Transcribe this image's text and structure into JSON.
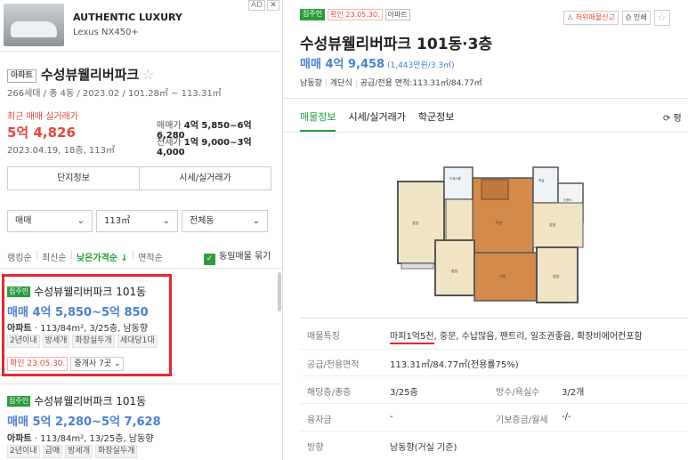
{
  "ad": {
    "title": "AUTHENTIC LUXURY",
    "subtitle": "Lexus NX450+",
    "badge": "AD",
    "close": "✕"
  },
  "complex": {
    "type_badge": "아파트",
    "name": "수성뷰웰리버파크",
    "star": "☆",
    "info": "266세대 / 총 4동 / 2023.02 / 101.28㎡ ~ 113.31㎡",
    "recent_label": "최근 매매 실거래가",
    "recent_price": "5억 4,826",
    "recent_date": "2023.04.19, 18층, 113㎡",
    "sale_label": "매매가",
    "sale_range": "4억 5,850~6억 6,280",
    "jeonse_label": "전세가",
    "jeonse_range": "1억 9,000~3억 4,000"
  },
  "buttons": {
    "complex_info": "단지정보",
    "market_price": "시세/실거래가"
  },
  "filters": {
    "trade": "매매",
    "area": "113㎡",
    "dong": "전체동",
    "chev": "⌄"
  },
  "sort": {
    "ranking": "랭킹순",
    "latest": "최신순",
    "low_price": "낮은가격순 ↓",
    "area": "면적순",
    "sep": "|",
    "group_label": "동일매물 묶기",
    "check": "✓"
  },
  "listings": [
    {
      "badge": "집주인",
      "title": "수성뷰웰리버파크 101동",
      "price": "매매 4억 5,850~5억 850",
      "spec_type": "아파트",
      "spec": " · 113/84m², 3/25층, 남동향",
      "tags": [
        "2년이내",
        "방세개",
        "화장실두개",
        "세대당1대"
      ],
      "confirm": "확인 23.05.30.",
      "agents": "중개사 7곳 ⌄"
    },
    {
      "badge": "집주인",
      "title": "수성뷰웰리버파크 101동",
      "price": "매매 5억 2,280~5억 7,628",
      "spec_type": "아파트",
      "spec": " · 113/84m², 13/25층, 남동향",
      "tags": [
        "2년이내",
        "급매",
        "방세개",
        "화장실두개"
      ]
    }
  ],
  "detail": {
    "badge_owner": "집주인",
    "badge_confirm": "확인 23.05.30.",
    "badge_type": "아파트",
    "report": "허위매물신고",
    "print": "인쇄",
    "star": "☆",
    "title": "수성뷰웰리버파크 101동·3층",
    "price": "매매 4억 9,458",
    "price_per": " (1,443만원/3.3㎡)",
    "meta": [
      "남동향",
      "계단식",
      "공급/전용 면적:113.31㎡/84.77㎡"
    ],
    "tabs": [
      "매물정보",
      "시세/실거래가",
      "학군정보"
    ],
    "refresh": "⟳ 평",
    "rows": [
      {
        "k": "매물특징",
        "v_hl": "마피1억5천",
        "v": ", 중문, 수납많음, 팬트리, 일조권좋음, 확장비에어컨포함"
      },
      {
        "k": "공급/전용면적",
        "v": "113.31㎡/84.77㎡(전용률75%)"
      },
      {
        "k": "해당층/총층",
        "v": "3/25층",
        "k2": "방수/욕실수",
        "v2": "3/2개"
      },
      {
        "k": "융자금",
        "v": "-",
        "k2": "기보증금/월세",
        "v2": "-/-"
      },
      {
        "k": "방향",
        "v": "남동향(거실 기준)"
      }
    ]
  },
  "colors": {
    "accent_green": "#2a9d3a",
    "price_blue": "#4a7fd3",
    "alert_red": "#e8453c",
    "highlight_red": "#e5282f"
  }
}
